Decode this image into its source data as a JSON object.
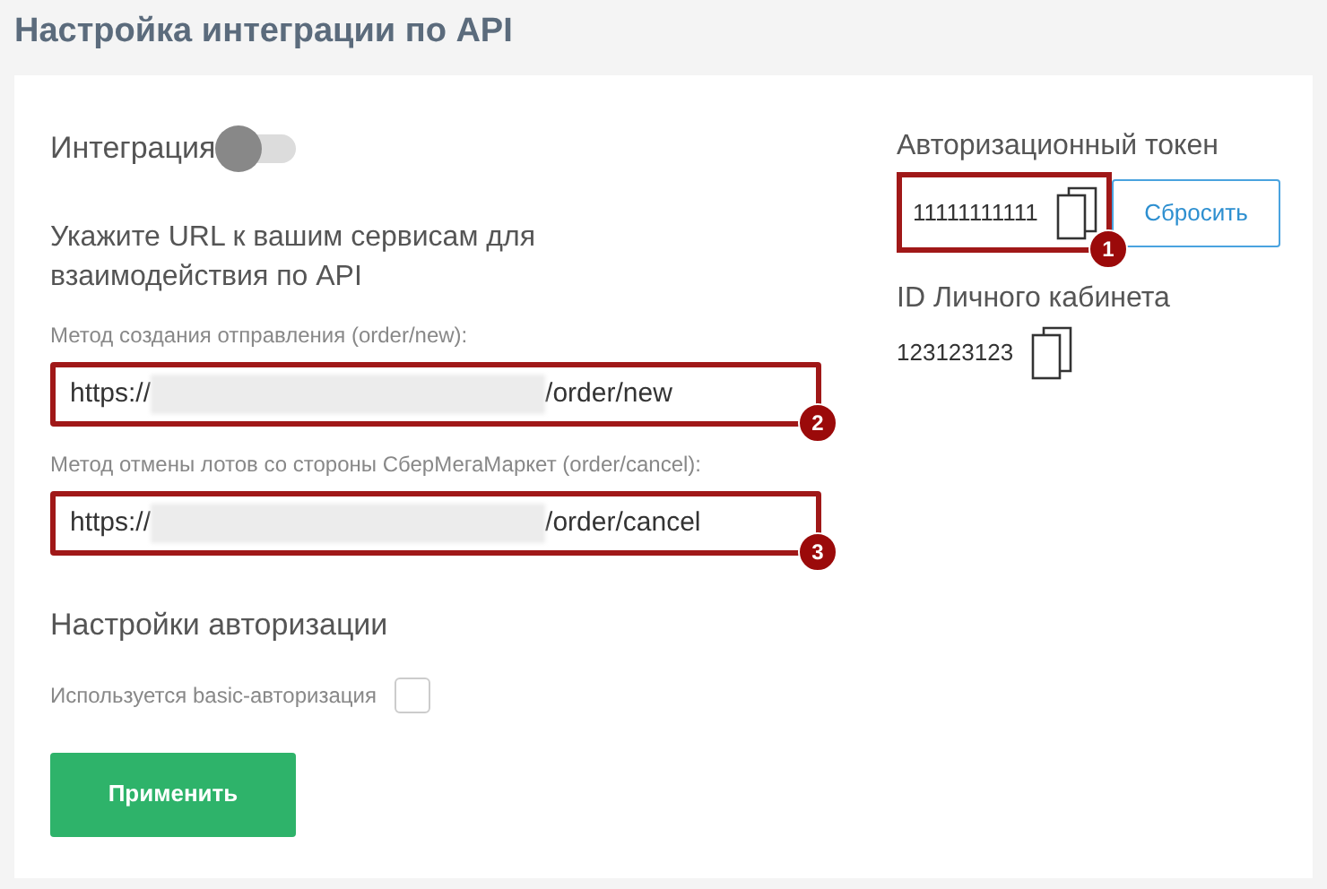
{
  "page_title": "Настройка интеграции по API",
  "integration": {
    "label": "Интеграция",
    "on": false
  },
  "url_section": {
    "heading": "Укажите URL к вашим сервисам для взаимодействия по API",
    "fields": [
      {
        "label": "Метод создания отправления (order/new):",
        "value_start": "https://",
        "value_end": "/order/new",
        "redacted": true,
        "callout": "2"
      },
      {
        "label": "Метод отмены лотов со стороны СберМегаМаркет (order/cancel):",
        "value_start": "https://",
        "value_end": "/order/cancel",
        "redacted": true,
        "callout": "3"
      }
    ]
  },
  "auth_settings": {
    "heading": "Настройки авторизации",
    "basic_auth": {
      "label": "Используется basic-авторизация",
      "checked": false
    }
  },
  "apply_button": "Применить",
  "token": {
    "label": "Авторизационный токен",
    "value": "11111111111",
    "callout": "1",
    "reset_button": "Сбросить"
  },
  "account_id": {
    "label": "ID Личного кабинета",
    "value": "123123123"
  }
}
